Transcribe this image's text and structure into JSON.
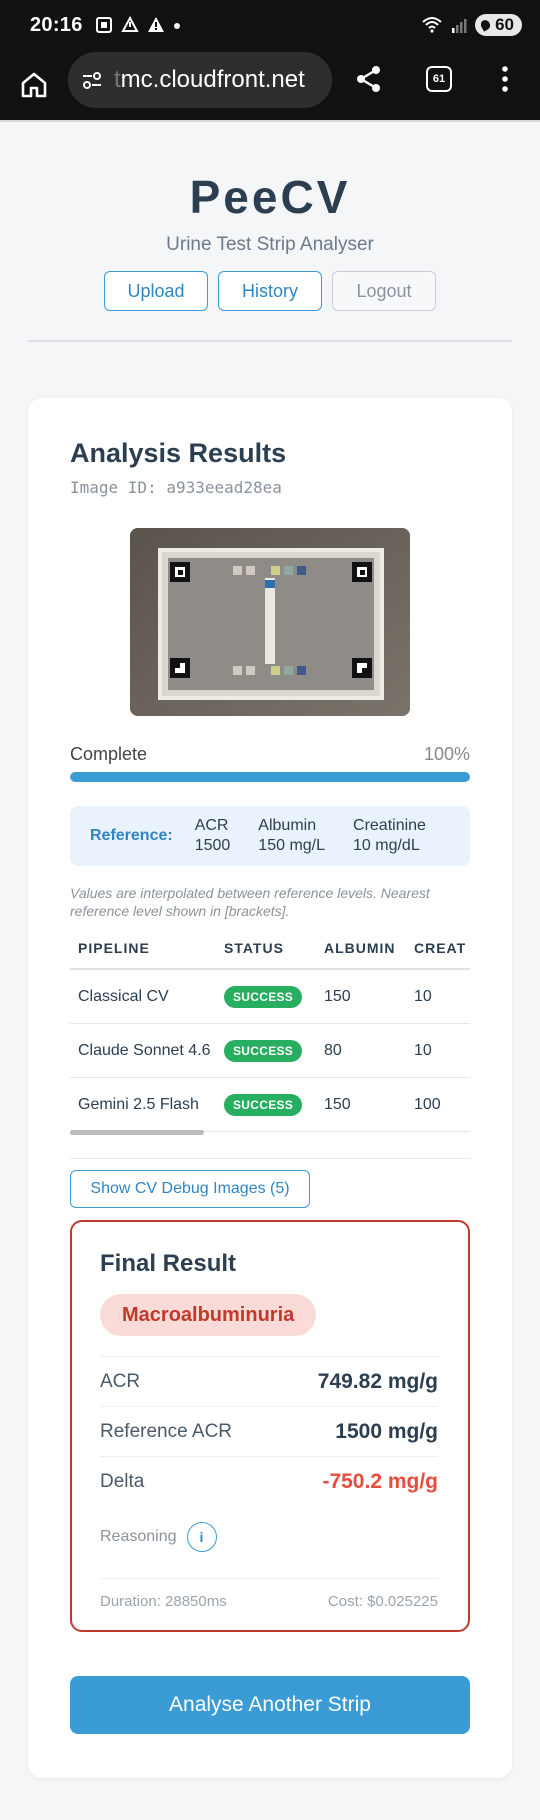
{
  "status_bar": {
    "time": "20:16",
    "battery": "60",
    "icons": [
      "screenshot-icon",
      "notification-icon",
      "warning-icon",
      "dot-icon",
      "wifi-icon",
      "signal-icon",
      "battery-icon"
    ]
  },
  "browser": {
    "url_faint": "t",
    "url": "mc.cloudfront.net",
    "tab_count": "61"
  },
  "app": {
    "name": "PeeCV",
    "tagline": "Urine Test Strip Analyser",
    "nav": {
      "upload": "Upload",
      "history": "History",
      "logout": "Logout"
    }
  },
  "results": {
    "title": "Analysis Results",
    "image_id": "Image ID: a933eead28ea",
    "progress": {
      "label": "Complete",
      "percent_text": "100%",
      "value": 1.0
    },
    "reference": {
      "label": "Reference:",
      "items": [
        {
          "name": "ACR",
          "value": "1500"
        },
        {
          "name": "Albumin",
          "value": "150 mg/L"
        },
        {
          "name": "Creatinine",
          "value": "10 mg/dL"
        }
      ]
    },
    "note": "Values are interpolated between reference levels. Nearest reference level shown in [brackets].",
    "table": {
      "headers": [
        "PIPELINE",
        "STATUS",
        "ALBUMIN",
        "CREAT"
      ],
      "rows": [
        {
          "pipeline": "Classical CV",
          "status": "SUCCESS",
          "albumin": "150",
          "creat": "10"
        },
        {
          "pipeline": "Claude Sonnet 4.6",
          "status": "SUCCESS",
          "albumin": "80",
          "creat": "10"
        },
        {
          "pipeline": "Gemini 2.5 Flash",
          "status": "SUCCESS",
          "albumin": "150",
          "creat": "100"
        }
      ]
    },
    "debug_button": "Show CV Debug Images (5)",
    "final": {
      "title": "Final Result",
      "diagnosis": "Macroalbuminuria",
      "acr_label": "ACR",
      "acr_value": "749.82 mg/g",
      "ref_acr_label": "Reference ACR",
      "ref_acr_value": "1500 mg/g",
      "delta_label": "Delta",
      "delta_value": "-750.2 mg/g",
      "reasoning_label": "Reasoning",
      "info_icon": "i",
      "duration": "Duration: 28850ms",
      "cost": "Cost: $0.025225"
    },
    "cta": "Analyse Another Strip"
  },
  "colors": {
    "accent": "#3a9bd5",
    "success": "#27ae60",
    "danger": "#c0392b",
    "delta_negative": "#e74c3c",
    "heading": "#2c3e50"
  }
}
